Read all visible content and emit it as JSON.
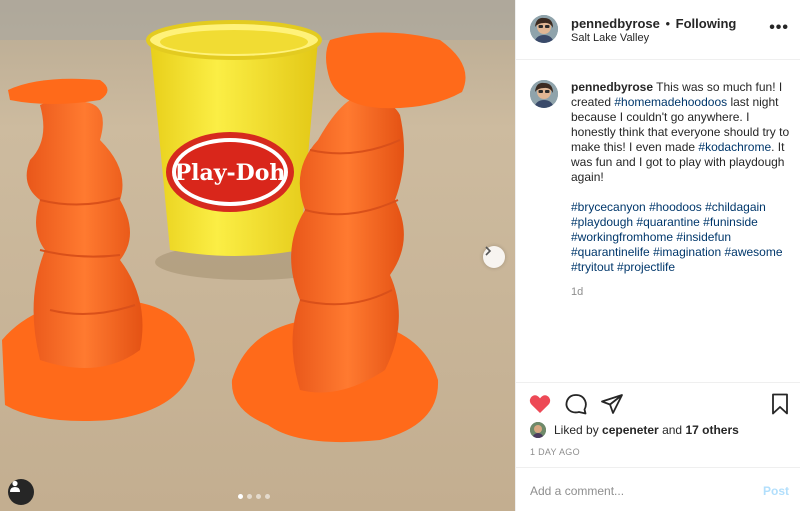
{
  "post": {
    "username": "pennedbyrose",
    "separator": "•",
    "follow_status": "Following",
    "location": "Salt Lake Valley",
    "more_icon": "more-horizontal-icon",
    "caption": {
      "username": "pennedbyrose",
      "text_1": " This was so much fun! I created ",
      "tag_inline_1": "#homemadehoodoos",
      "text_2": " last night because I couldn't go anywhere. I honestly think that everyone should try to make this! I even made ",
      "tag_inline_2": "#kodachrome",
      "text_3": ". It was fun and I got to play with playdough again!",
      "hashtags": [
        "#brycecanyon",
        "#hoodoos",
        "#childagain",
        "#playdough",
        "#quarantine",
        "#funinside",
        "#workingfromhome",
        "#insidefun",
        "#quarantinelife",
        "#imagination",
        "#awesome",
        "#tryitout",
        "#projectlife"
      ],
      "time_ago": "1d"
    },
    "likes": {
      "prefix": "Liked by ",
      "liker": "cepeneter",
      "middle": " and ",
      "others": "17 others"
    },
    "date": "1 DAY AGO",
    "comment_placeholder": "Add a comment...",
    "post_button": "Post",
    "carousel": {
      "total": 4,
      "active": 0
    },
    "icons": [
      "heart-icon",
      "comment-icon",
      "share-icon",
      "bookmark-icon",
      "tag-user-icon",
      "chevron-right-icon"
    ],
    "photo": {
      "brand_text": "Play-Doh",
      "colors": {
        "playdough": "#ff6a1a",
        "cup": "#f3e12a",
        "paper": "#c9b89d"
      }
    },
    "colors": {
      "heart": "#ed4956",
      "link": "#00376b",
      "muted": "#8e8e8e",
      "post_button": "#b2dffc"
    }
  }
}
